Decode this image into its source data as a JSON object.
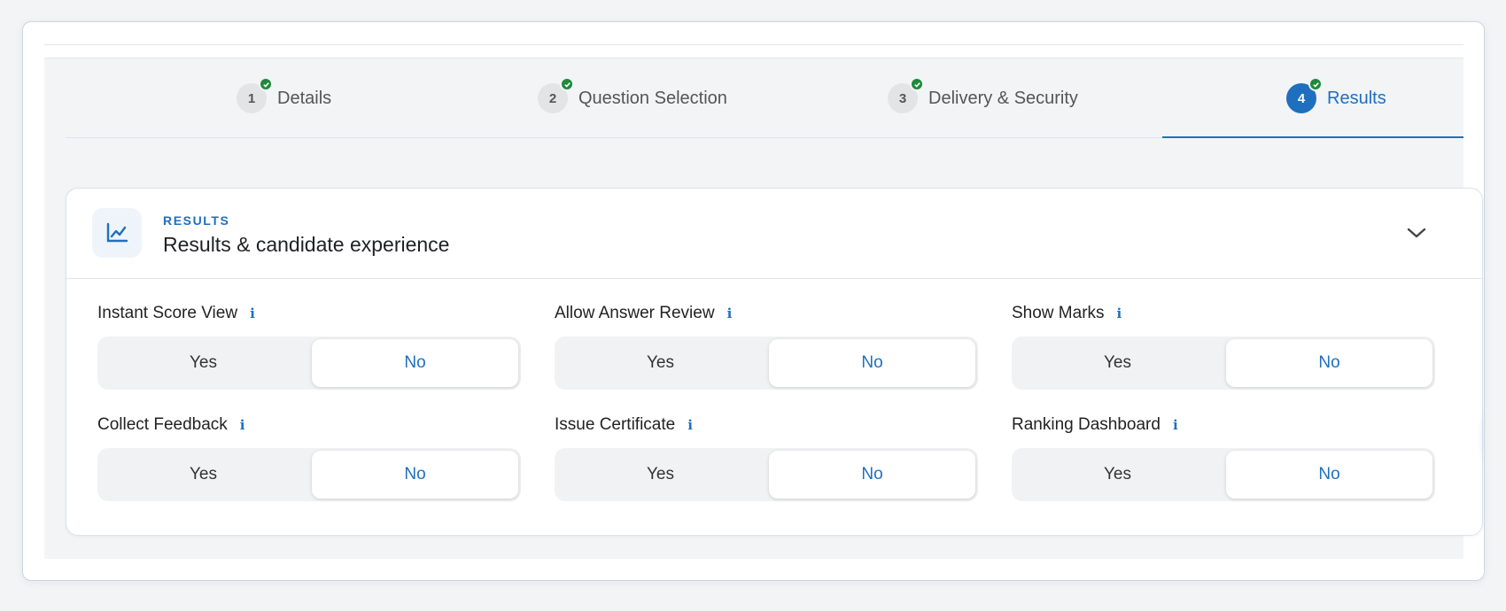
{
  "stepper": {
    "steps": [
      {
        "number": "1",
        "label": "Details",
        "completed": true,
        "active": false
      },
      {
        "number": "2",
        "label": "Question Selection",
        "completed": true,
        "active": false
      },
      {
        "number": "3",
        "label": "Delivery & Security",
        "completed": true,
        "active": false
      },
      {
        "number": "4",
        "label": "Results",
        "completed": true,
        "active": true
      }
    ]
  },
  "section": {
    "eyebrow": "RESULTS",
    "title": "Results & candidate experience",
    "icon": "line-chart-icon",
    "collapse_icon": "chevron-down-icon"
  },
  "fields": [
    {
      "label": "Instant Score View",
      "info": "i",
      "yes": "Yes",
      "no": "No",
      "selected": "No"
    },
    {
      "label": "Allow Answer Review",
      "info": "i",
      "yes": "Yes",
      "no": "No",
      "selected": "No"
    },
    {
      "label": "Show Marks",
      "info": "i",
      "yes": "Yes",
      "no": "No",
      "selected": "No"
    },
    {
      "label": "Collect Feedback",
      "info": "i",
      "yes": "Yes",
      "no": "No",
      "selected": "No"
    },
    {
      "label": "Issue Certificate",
      "info": "i",
      "yes": "Yes",
      "no": "No",
      "selected": "No"
    },
    {
      "label": "Ranking Dashboard",
      "info": "i",
      "yes": "Yes",
      "no": "No",
      "selected": "No"
    }
  ],
  "colors": {
    "accent": "#1f6fbf",
    "success": "#1e8a3a"
  }
}
